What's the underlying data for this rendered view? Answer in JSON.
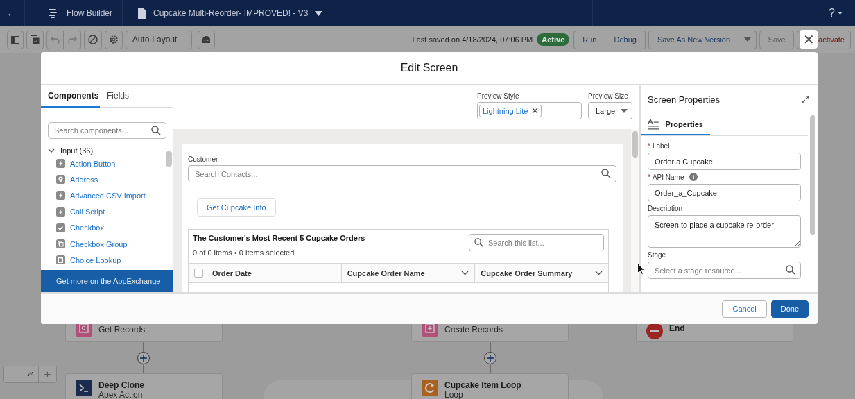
{
  "nav": {
    "back": "←",
    "app": "Flow Builder",
    "document": "Cupcake Multi-Reorder- IMPROVED! - V3",
    "help": "?"
  },
  "toolbar": {
    "undo": {
      "disabled": true
    },
    "redo": {
      "disabled": true
    },
    "layout": "Auto-Layout",
    "last_saved": "Last saved on 4/18/2024, 07:06 PM",
    "status": "Active",
    "run": "Run",
    "debug": "Debug",
    "save_as": "Save As New Version",
    "save": {
      "label": "Save",
      "disabled": true
    },
    "deactivate": "activate"
  },
  "canvas": {
    "nodes": [
      {
        "kind": "lookup",
        "subtitle": "Get Records"
      },
      {
        "kind": "apex",
        "title": "Deep Clone",
        "subtitle": "Apex Action"
      },
      {
        "kind": "create",
        "subtitle": "Create Records"
      },
      {
        "kind": "loop",
        "title": "Cupcake Item Loop",
        "subtitle": "Loop"
      },
      {
        "kind": "end",
        "title": "End"
      }
    ],
    "zoom_out": "—",
    "zoom_in": {
      "label": "+",
      "disabled": true
    }
  },
  "modal": {
    "title": "Edit Screen",
    "close": "✕",
    "left_tabs": [
      {
        "label": "Components",
        "selected": true
      },
      {
        "label": "Fields",
        "selected": false
      }
    ],
    "search_placeholder": "Search components...",
    "palette": [
      {
        "label": "Input (36)",
        "expanded": true,
        "children": [
          {
            "label": "Action Button"
          },
          {
            "label": "Address"
          },
          {
            "label": "Advanced CSV Import"
          },
          {
            "label": "Call Script"
          },
          {
            "label": "Checkbox"
          },
          {
            "label": "Checkbox Group"
          },
          {
            "label": "Choice Lookup"
          }
        ]
      }
    ],
    "appexchange": "Get more on the AppExchange",
    "preview": {
      "style_label": "Preview Style",
      "style_value": "Lightning Lite",
      "size_label": "Preview Size",
      "size_value": "Large"
    },
    "screen": {
      "customer_label": "Customer",
      "customer_placeholder": "Search Contacts...",
      "button": "Get Cupcake Info",
      "table": {
        "title": "The Customer's Most Recent 5 Cupcake Orders",
        "summary": "0 of 0 items • 0 items selected",
        "search_placeholder": "Search this list...",
        "select_all": {
          "checked": false
        },
        "columns": [
          {
            "label": "Order Date",
            "menu": false
          },
          {
            "label": "Cupcake Order Name",
            "menu": true
          },
          {
            "label": "Cupcake Order Summary",
            "menu": true
          }
        ]
      }
    },
    "properties": {
      "title": "Screen Properties",
      "tab": "Properties",
      "required_marker": "*",
      "fields": [
        {
          "kind": "text",
          "label": "Label",
          "required": true,
          "info": false,
          "value": "Order a Cupcake"
        },
        {
          "kind": "text",
          "label": "API Name",
          "required": true,
          "info": true,
          "value": "Order_a_Cupcake"
        },
        {
          "kind": "textarea",
          "label": "Description",
          "required": false,
          "info": false,
          "value": "Screen to place a cupcake re-order"
        },
        {
          "kind": "search",
          "label": "Stage",
          "required": false,
          "info": false,
          "placeholder": "Select a stage resource..."
        }
      ]
    },
    "footer": {
      "cancel": "Cancel",
      "done": "Done"
    }
  }
}
